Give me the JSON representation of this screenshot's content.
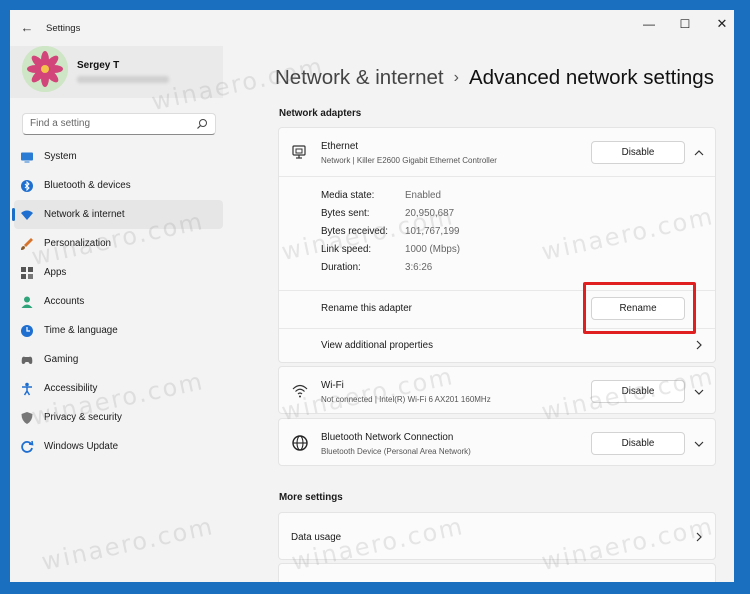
{
  "window": {
    "title": "Settings",
    "controls": {
      "minimize": "—",
      "maximize": "☐",
      "close": "✕"
    }
  },
  "profile": {
    "name": "Sergey T"
  },
  "search": {
    "placeholder": "Find a setting"
  },
  "sidebar": {
    "items": [
      {
        "label": "System",
        "icon": "display-icon",
        "color": "#2a7bd4"
      },
      {
        "label": "Bluetooth & devices",
        "icon": "bluetooth-icon",
        "color": "#1f6fd1"
      },
      {
        "label": "Network & internet",
        "icon": "wifi-icon",
        "color": "#1f6fd1",
        "active": true
      },
      {
        "label": "Personalization",
        "icon": "brush-icon",
        "color": "#d8732b"
      },
      {
        "label": "Apps",
        "icon": "apps-icon",
        "color": "#555555"
      },
      {
        "label": "Accounts",
        "icon": "person-icon",
        "color": "#2fa37a"
      },
      {
        "label": "Time & language",
        "icon": "globe-clock-icon",
        "color": "#1f6fd1"
      },
      {
        "label": "Gaming",
        "icon": "gamepad-icon",
        "color": "#666666"
      },
      {
        "label": "Accessibility",
        "icon": "accessibility-icon",
        "color": "#1f6fd1"
      },
      {
        "label": "Privacy & security",
        "icon": "shield-icon",
        "color": "#777777"
      },
      {
        "label": "Windows Update",
        "icon": "update-icon",
        "color": "#1f6fd1"
      }
    ]
  },
  "breadcrumb": {
    "parent": "Network & internet",
    "separator": "›",
    "current": "Advanced network settings"
  },
  "network_adapters": {
    "title": "Network adapters",
    "ethernet": {
      "name": "Ethernet",
      "description": "Network | Killer E2600 Gigabit Ethernet Controller",
      "button": "Disable",
      "properties": [
        {
          "label": "Media state:",
          "value": "Enabled"
        },
        {
          "label": "Bytes sent:",
          "value": "20,950,687"
        },
        {
          "label": "Bytes received:",
          "value": "101,767,199"
        },
        {
          "label": "Link speed:",
          "value": "1000 (Mbps)"
        },
        {
          "label": "Duration:",
          "value": "3:6:26"
        }
      ],
      "rename_label": "Rename this adapter",
      "rename_button": "Rename",
      "additional_label": "View additional properties"
    },
    "wifi": {
      "name": "Wi-Fi",
      "description": "Not connected | Intel(R) Wi-Fi 6 AX201 160MHz",
      "button": "Disable"
    },
    "bluetooth": {
      "name": "Bluetooth Network Connection",
      "description": "Bluetooth Device (Personal Area Network)",
      "button": "Disable"
    }
  },
  "more_settings": {
    "title": "More settings",
    "items": [
      {
        "label": "Data usage"
      }
    ]
  },
  "watermark": "winaero.com",
  "colors": {
    "accent": "#1a6fc8",
    "highlight": "#e02020",
    "desktop": "#1b6fbf"
  }
}
